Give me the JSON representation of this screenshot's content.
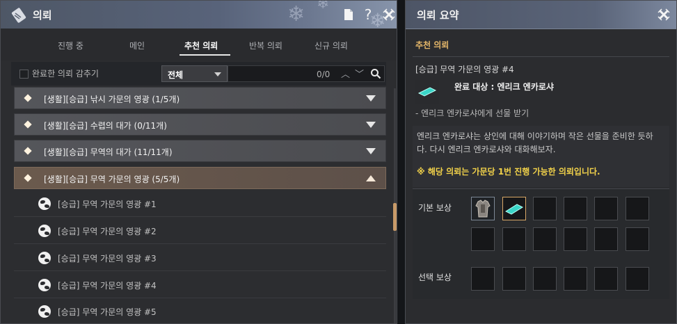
{
  "left_panel": {
    "title": "의뢰",
    "tabs": [
      "진행 중",
      "메인",
      "추천 의뢰",
      "반복 의뢰",
      "신규 의뢰"
    ],
    "active_tab": "추천 의뢰",
    "filter": {
      "hide_completed_label": "완료한 의뢰 감추기",
      "dropdown_value": "전체",
      "result_count": "0/0"
    },
    "quest_groups": [
      {
        "label": "[생활][승급] 낚시 가문의 영광 (1/5개)",
        "expanded": false
      },
      {
        "label": "[생활][승급] 수렵의 대가 (0/11개)",
        "expanded": false
      },
      {
        "label": "[생활][승급] 무역의 대가 (11/11개)",
        "expanded": false
      },
      {
        "label": "[생활][승급] 무역 가문의 영광 (5/5개)",
        "expanded": true
      }
    ],
    "sub_quests": [
      "[승급] 무역 가문의 영광 #1",
      "[승급] 무역 가문의 영광 #2",
      "[승급] 무역 가문의 영광 #3",
      "[승급] 무역 가문의 영광 #4",
      "[승급] 무역 가문의 영광 #5"
    ]
  },
  "right_panel": {
    "title": "의뢰 요약",
    "category": "추천 의뢰",
    "quest_name": "[승급] 무역 가문의 영광 #4",
    "completion_target": "완료 대상 : 엔리크 엔카로샤",
    "objective": "- 엔리크 엔카로샤에게 선물 받기",
    "description": "엔리크 엔카로샤는 상인에 대해 이야기하며 작은 선물을 준비한 듯하다. 다시 엔리크 엔카로샤와 대화해보자.",
    "notice": "※ 해당 의뢰는 가문당 1번 진행 가능한 의뢰입니다.",
    "basic_reward_label": "기본 보상",
    "select_reward_label": "선택 보상"
  },
  "colors": {
    "accent_gold": "#e6b86a",
    "notice_yellow": "#f2d24a",
    "title_bar": "#58637a"
  }
}
